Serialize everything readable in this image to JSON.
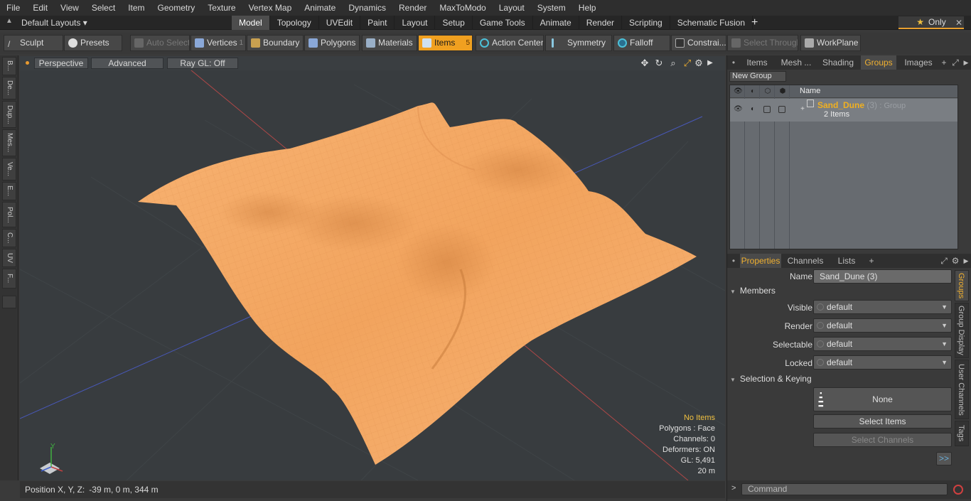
{
  "menu": [
    "File",
    "Edit",
    "View",
    "Select",
    "Item",
    "Geometry",
    "Texture",
    "Vertex Map",
    "Animate",
    "Dynamics",
    "Render",
    "MaxToModo",
    "Layout",
    "System",
    "Help"
  ],
  "layout": {
    "name": "Default Layouts ▾"
  },
  "tabs": [
    "Model",
    "Topology",
    "UVEdit",
    "Paint",
    "Layout",
    "Setup",
    "Game Tools",
    "Animate",
    "Render",
    "Scripting",
    "Schematic Fusion"
  ],
  "only_label": "Only",
  "toolbar": {
    "sculpt": "Sculpt",
    "presets": "Presets",
    "auto_select": "Auto Select",
    "vertices": "Vertices",
    "vertices_count": "1",
    "boundary": "Boundary",
    "polygons": "Polygons",
    "materials": "Materials",
    "items": "Items",
    "items_count": "5",
    "action_center": "Action Center",
    "symmetry": "Symmetry",
    "falloff": "Falloff",
    "constraints": "Constrai...",
    "select_through": "Select Through",
    "workplane": "WorkPlane"
  },
  "left_tabs": [
    "B...",
    "De...",
    "Dup...",
    "Mes...",
    "Ve...",
    "E...",
    "Pol...",
    "C...",
    "UV",
    "F..."
  ],
  "viewport": {
    "perspective": "Perspective",
    "advanced": "Advanced",
    "raygl": "Ray GL: Off",
    "info": {
      "items": "No Items",
      "polygons": "Polygons : Face",
      "channels": "Channels: 0",
      "deformers": "Deformers: ON",
      "gl": "GL: 5,491",
      "scale": "20 m"
    },
    "axis": {
      "y": "Y"
    }
  },
  "status": {
    "label": "Position X, Y, Z:",
    "value": "-39 m, 0 m, 344 m"
  },
  "panel_tabs": [
    "Items",
    "Mesh ...",
    "Shading",
    "Groups",
    "Images"
  ],
  "groups": {
    "new_group": "New Group",
    "name_header": "Name",
    "row": {
      "name": "Sand_Dune",
      "count": "(3)",
      "type": ": Group",
      "sub": "2 Items"
    }
  },
  "prop_tabs": [
    "Properties",
    "Channels",
    "Lists"
  ],
  "properties": {
    "name_label": "Name",
    "name_value": "Sand_Dune (3)",
    "members": "Members",
    "visible_label": "Visible",
    "visible_value": "default",
    "render_label": "Render",
    "render_value": "default",
    "selectable_label": "Selectable",
    "selectable_value": "default",
    "locked_label": "Locked",
    "locked_value": "default",
    "sel_keying": "Selection & Keying",
    "none": "None",
    "select_items": "Select Items",
    "select_channels": "Select Channels",
    "more": ">>"
  },
  "side_tabs": [
    "Groups",
    "Group Display",
    "User Channels",
    "Tags"
  ],
  "command": {
    "placeholder": "Command",
    "prompt": ">"
  },
  "colors": {
    "accent": "#f0a020",
    "mesh": "#f5a868",
    "viewport_bg": "#383c3f"
  }
}
